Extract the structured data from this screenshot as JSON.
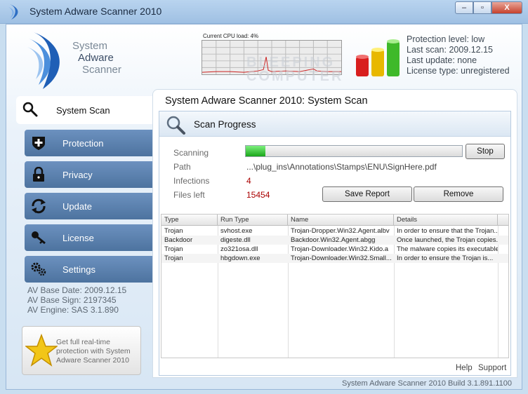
{
  "window": {
    "title": "System Adware Scanner 2010",
    "minimize_label": "–",
    "maximize_label": "▫",
    "close_label": "X"
  },
  "logo": {
    "line1": "System",
    "line2": "Adware",
    "line3": "Scanner"
  },
  "cpu": {
    "label": "Current CPU load: 4%"
  },
  "watermark": {
    "line1": "BLEEPING",
    "line2": "COMPUTER"
  },
  "status": {
    "protection_level": "Protection level: low",
    "last_scan": "Last scan: 2009.12.15",
    "last_update": "Last update: none",
    "license_type": "License type: unregistered"
  },
  "nav": {
    "items": [
      {
        "label": "System Scan",
        "icon": "magnifier-icon",
        "active": true
      },
      {
        "label": "Protection",
        "icon": "shield-plus-icon"
      },
      {
        "label": "Privacy",
        "icon": "padlock-icon"
      },
      {
        "label": "Update",
        "icon": "refresh-arrows-icon"
      },
      {
        "label": "License",
        "icon": "key-icon"
      },
      {
        "label": "Settings",
        "icon": "gears-icon"
      }
    ]
  },
  "av_info": {
    "base_date": "AV Base Date: 2009.12.15",
    "base_sign": "AV Base Sign: 2197345",
    "engine": "AV Engine: SAS 3.1.890"
  },
  "promo": {
    "text": "Get full real-time protection with System Adware Scanner 2010"
  },
  "panel": {
    "title": "System Adware Scanner 2010: System Scan"
  },
  "scan": {
    "header": "Scan Progress",
    "scanning_label": "Scanning",
    "path_label": "Path",
    "path_value": "...\\plug_ins\\Annotations\\Stamps\\ENU\\SignHere.pdf",
    "infections_label": "Infections",
    "infections_value": "4",
    "files_left_label": "Files left",
    "files_left_value": "15454",
    "progress": 0.09,
    "stop_label": "Stop",
    "save_report_label": "Save Report",
    "remove_label": "Remove"
  },
  "table": {
    "headers": [
      "Type",
      "Run Type",
      "Name",
      "Details"
    ],
    "rows": [
      [
        "Trojan",
        "svhost.exe",
        "Trojan-Dropper.Win32.Agent.albv",
        "In order to ensure that the Trojan..."
      ],
      [
        "Backdoor",
        "digeste.dll",
        "Backdoor.Win32.Agent.abgg",
        "Once launched, the Trojan copies..."
      ],
      [
        "Trojan",
        "zo321osa.dll",
        "Trojan-Downloader.Win32.Kido.a",
        "The malware copies its executable..."
      ],
      [
        "Trojan",
        "hbgdown.exe",
        "Trojan-Downloader.Win32.Small...",
        "In order to ensure the Trojan is..."
      ]
    ]
  },
  "footer": {
    "help": "Help",
    "support": "Support",
    "build": "System Adware Scanner 2010 Build 3.1.891.1100"
  },
  "colors": {
    "accent": "#4d739f",
    "infection_red": "#aa0000",
    "progress_green": "#1aa61a"
  }
}
